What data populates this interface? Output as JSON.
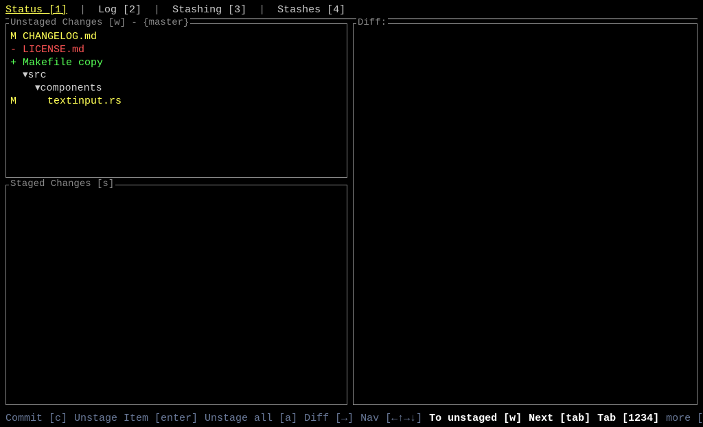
{
  "tabs": [
    {
      "label": "Status [1]",
      "active": true
    },
    {
      "label": "Log [2]",
      "active": false
    },
    {
      "label": "Stashing [3]",
      "active": false
    },
    {
      "label": "Stashes [4]",
      "active": false
    }
  ],
  "panels": {
    "unstaged_title": "Unstaged Changes [w] - {master}",
    "staged_title": "Staged Changes [s]",
    "diff_title": "Diff:"
  },
  "unstaged_files": [
    {
      "status": "M",
      "name": "CHANGELOG.md",
      "class": "modified",
      "indent": ""
    },
    {
      "status": "-",
      "name": "LICENSE.md",
      "class": "deleted",
      "indent": ""
    },
    {
      "status": "+",
      "name": "Makefile copy",
      "class": "added",
      "indent": ""
    },
    {
      "status": " ",
      "name": "▾src",
      "class": "tree",
      "indent": " "
    },
    {
      "status": " ",
      "name": "▾components",
      "class": "tree",
      "indent": "   "
    },
    {
      "status": "M",
      "name": "textinput.rs",
      "class": "modified",
      "indent": "     "
    }
  ],
  "footer": {
    "commit": "Commit [c]",
    "unstage_item": "Unstage Item [enter]",
    "unstage_all": "Unstage all [a]",
    "diff": "Diff [→]",
    "nav": "Nav [←↑→↓]",
    "to_unstaged": "To unstaged [w]",
    "next": "Next [tab]",
    "tab": "Tab [1234]",
    "more": "more [.]"
  }
}
